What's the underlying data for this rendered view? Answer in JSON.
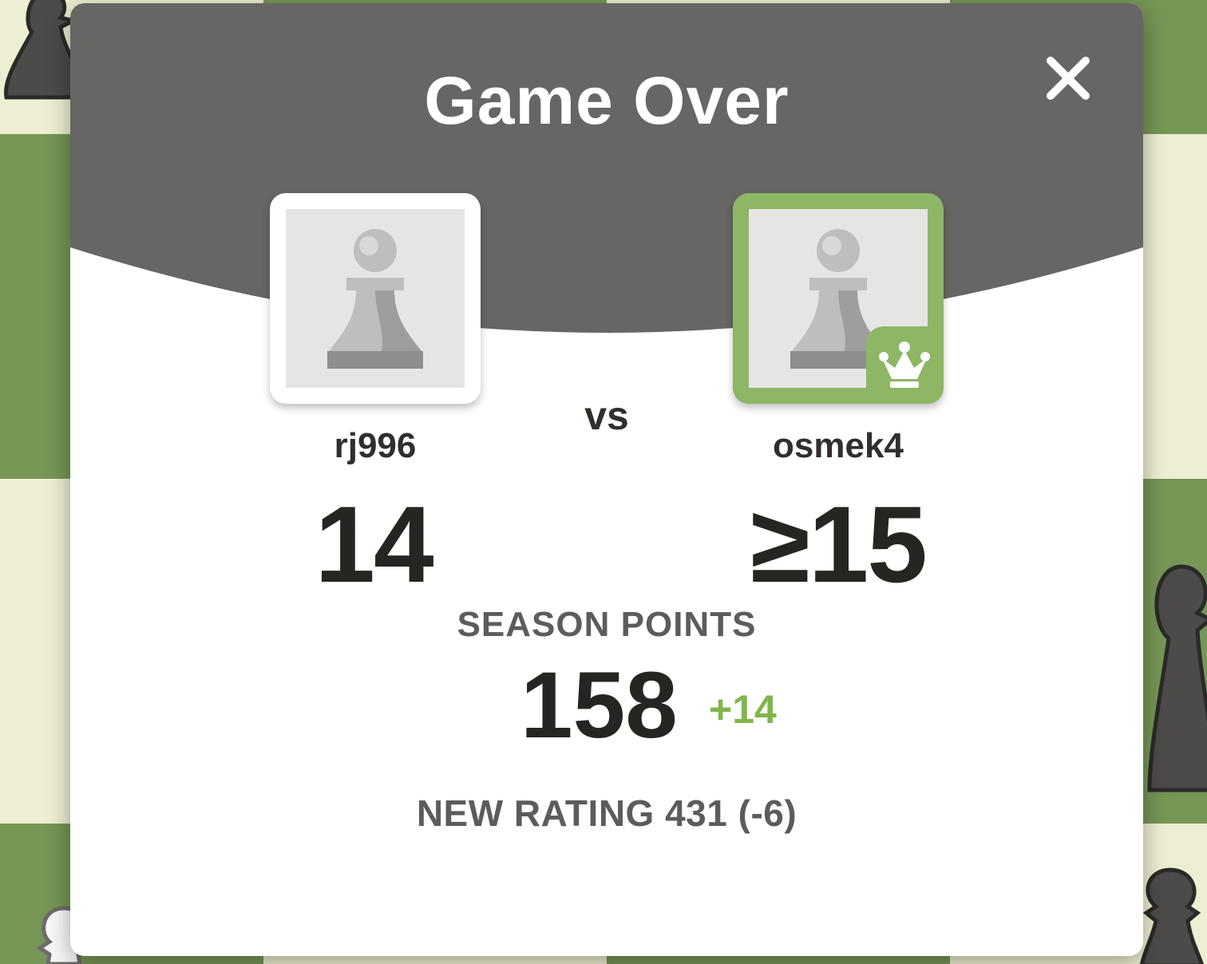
{
  "colors": {
    "header_bg": "#676665",
    "board_dark": "#769656",
    "board_light": "#eeeed2",
    "winner_accent": "#8db665",
    "positive_delta": "#81b64c",
    "text_dark": "#272522",
    "text_muted": "#5e5c5a"
  },
  "modal": {
    "title": "Game Over",
    "close_icon": "close-icon",
    "vs_label": "vs"
  },
  "players": {
    "left": {
      "username": "rj996",
      "avatar_icon": "pawn-avatar-icon",
      "score": "14",
      "is_winner": false
    },
    "right": {
      "username": "osmek4",
      "avatar_icon": "pawn-avatar-icon",
      "score": "≥15",
      "is_winner": true,
      "badge_icon": "crown-icon"
    }
  },
  "season": {
    "label": "SEASON POINTS",
    "points": "158",
    "delta": "+14"
  },
  "rating": {
    "text": "NEW RATING 431 (-6)"
  }
}
